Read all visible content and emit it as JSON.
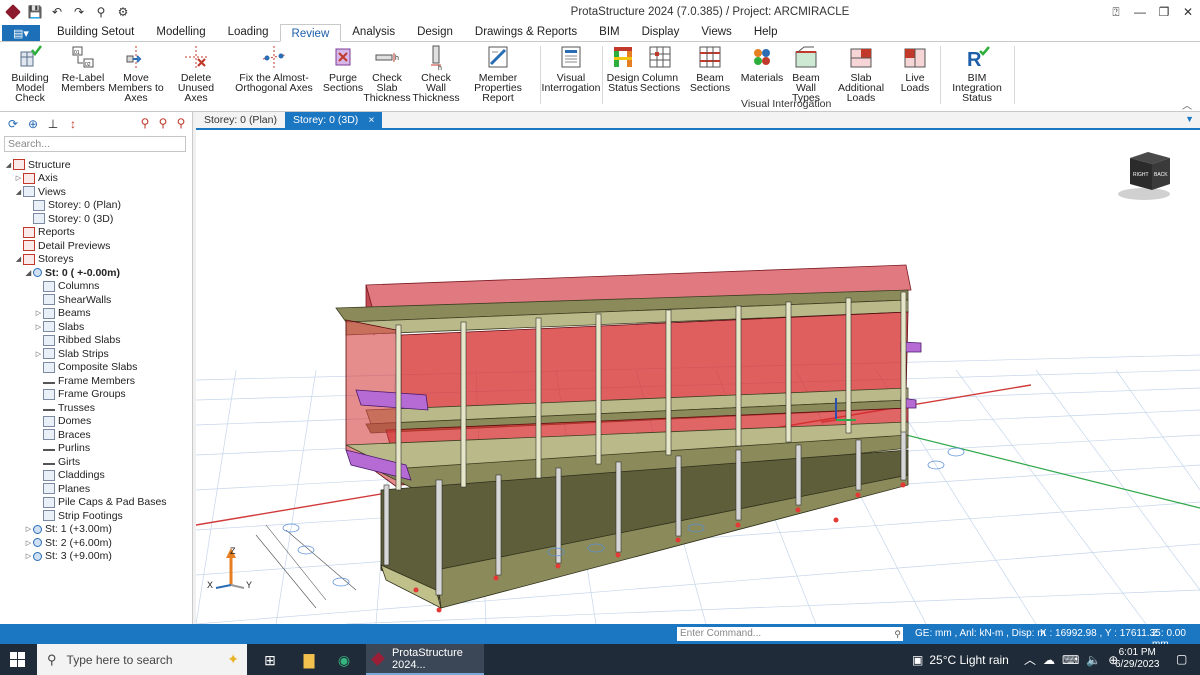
{
  "window": {
    "title": "ProtaStructure 2024 (7.0.385) / Project: ARCMIRACLE"
  },
  "ribbon_tabs": [
    "Building Setout",
    "Modelling",
    "Loading",
    "Review",
    "Analysis",
    "Design",
    "Drawings & Reports",
    "BIM",
    "Display",
    "Views",
    "Help"
  ],
  "active_tab": "Review",
  "ribbon": {
    "building_model_check": "Building Model Check",
    "relabel_members": "Re-Label Members",
    "move_members": "Move Members to Axes",
    "delete_unused_axes": "Delete Unused Axes",
    "fix_axes": "Fix the Almost-Orthogonal Axes",
    "purge_sections": "Purge Sections",
    "check_slab": "Check Slab Thickness",
    "check_wall": "Check Wall Thickness",
    "member_properties": "Member Properties Report",
    "visual_interrogation_btn": "Visual Interrogation",
    "design_status": "Design Status",
    "column_sections": "Column Sections",
    "beam_sections": "Beam Sections",
    "materials": "Materials",
    "beam_wall_types": "Beam Wall Types",
    "slab_additional_loads": "Slab Additional Loads",
    "live_loads": "Live Loads",
    "bim_integration_status": "BIM Integration Status",
    "group_visual_interrogation": "Visual Interrogation"
  },
  "left_panel": {
    "search_placeholder": "Search...",
    "tree": [
      {
        "label": "Structure",
        "level": 0,
        "arrow": "open",
        "icon": "structure"
      },
      {
        "label": "Axis",
        "level": 1,
        "arrow": "closed",
        "icon": "axis"
      },
      {
        "label": "Views",
        "level": 1,
        "arrow": "open",
        "icon": "views"
      },
      {
        "label": "Storey: 0 (Plan)",
        "level": 2,
        "arrow": "",
        "icon": "plan"
      },
      {
        "label": "Storey: 0 (3D)",
        "level": 2,
        "arrow": "",
        "icon": "3d"
      },
      {
        "label": "Reports",
        "level": 1,
        "arrow": "",
        "icon": "reports"
      },
      {
        "label": "Detail Previews",
        "level": 1,
        "arrow": "",
        "icon": "detail"
      },
      {
        "label": "Storeys",
        "level": 1,
        "arrow": "open",
        "icon": "storeys"
      },
      {
        "label": "St: 0 ( +-0.00m)",
        "level": 2,
        "arrow": "open",
        "icon": "storey",
        "bold": true
      },
      {
        "label": "Columns",
        "level": 3,
        "arrow": "",
        "icon": "columns"
      },
      {
        "label": "ShearWalls",
        "level": 3,
        "arrow": "",
        "icon": "shearwalls"
      },
      {
        "label": "Beams",
        "level": 3,
        "arrow": "closed",
        "icon": "beams"
      },
      {
        "label": "Slabs",
        "level": 3,
        "arrow": "closed",
        "icon": "slabs"
      },
      {
        "label": "Ribbed Slabs",
        "level": 3,
        "arrow": "",
        "icon": "ribbed"
      },
      {
        "label": "Slab Strips",
        "level": 3,
        "arrow": "closed",
        "icon": "strips"
      },
      {
        "label": "Composite Slabs",
        "level": 3,
        "arrow": "",
        "icon": "composite"
      },
      {
        "label": "Frame Members",
        "level": 3,
        "arrow": "",
        "icon": "frame"
      },
      {
        "label": "Frame Groups",
        "level": 3,
        "arrow": "",
        "icon": "framegroups"
      },
      {
        "label": "Trusses",
        "level": 3,
        "arrow": "",
        "icon": "trusses"
      },
      {
        "label": "Domes",
        "level": 3,
        "arrow": "",
        "icon": "domes"
      },
      {
        "label": "Braces",
        "level": 3,
        "arrow": "",
        "icon": "braces"
      },
      {
        "label": "Purlins",
        "level": 3,
        "arrow": "",
        "icon": "purlins"
      },
      {
        "label": "Girts",
        "level": 3,
        "arrow": "",
        "icon": "girts"
      },
      {
        "label": "Claddings",
        "level": 3,
        "arrow": "",
        "icon": "claddings"
      },
      {
        "label": "Planes",
        "level": 3,
        "arrow": "",
        "icon": "planes"
      },
      {
        "label": "Pile Caps & Pad Bases",
        "level": 3,
        "arrow": "",
        "icon": "pilecaps"
      },
      {
        "label": "Strip Footings",
        "level": 3,
        "arrow": "",
        "icon": "strip"
      },
      {
        "label": "St: 1 (+3.00m)",
        "level": 2,
        "arrow": "closed",
        "icon": "storey"
      },
      {
        "label": "St: 2 (+6.00m)",
        "level": 2,
        "arrow": "closed",
        "icon": "storey"
      },
      {
        "label": "St: 3 (+9.00m)",
        "level": 2,
        "arrow": "closed",
        "icon": "storey"
      }
    ]
  },
  "doc_tabs": [
    "Storey: 0 (Plan)",
    "Storey: 0 (3D)"
  ],
  "active_doc_tab": "Storey: 0 (3D)",
  "doc_tab_close": "×",
  "viewcube": {
    "face1": "RIGHT",
    "face2": "BACK"
  },
  "axes_labels": {
    "z": "Z",
    "x": "X",
    "y": "Y"
  },
  "statusbar": {
    "command_placeholder": "Enter Command...",
    "units": "GE: mm , Anl: kN-m , Disp: m",
    "xy": "X : 16992.98 , Y : 17611.35",
    "z": "Z : 0.00 mm"
  },
  "taskbar": {
    "search_placeholder": "Type here to search",
    "app_label": "ProtaStructure 2024...",
    "weather": "25°C  Light rain",
    "time": "6:01 PM",
    "date": "6/29/2023"
  }
}
